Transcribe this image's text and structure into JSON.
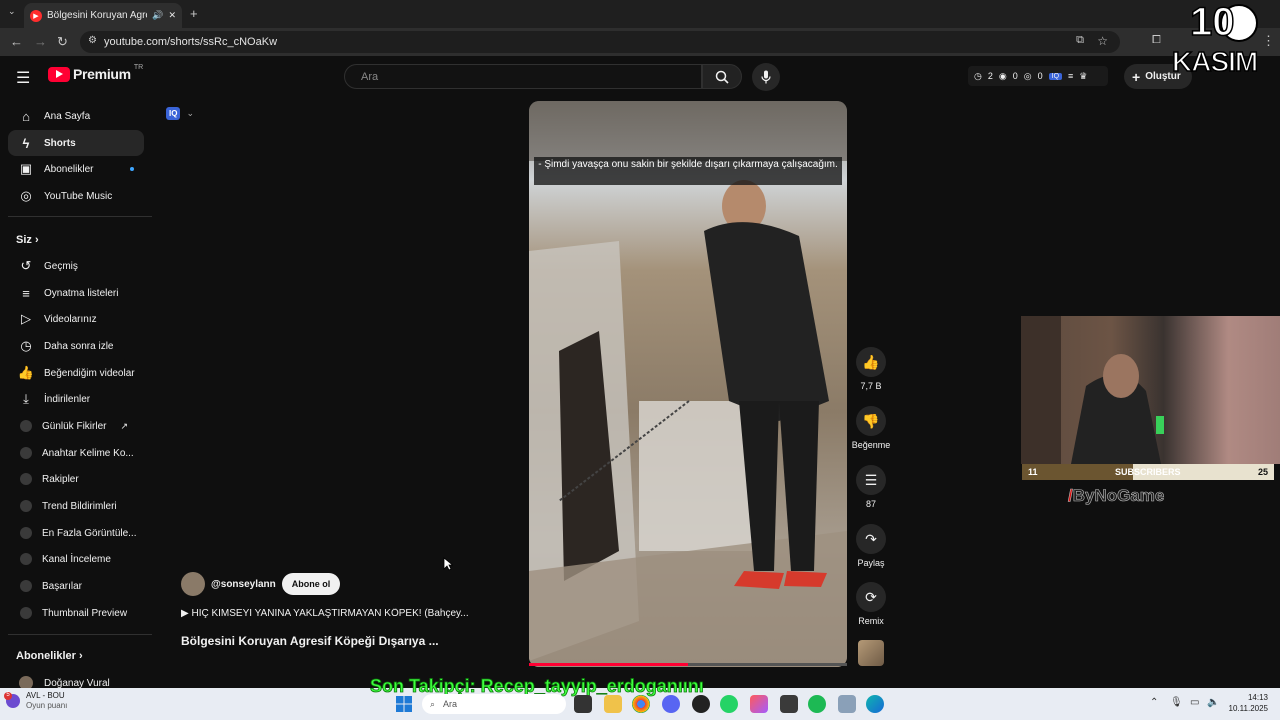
{
  "browser": {
    "tab_title": "Bölgesini Koruyan Agresif K",
    "tab_close": "✕",
    "new_tab": "+",
    "url": "youtube.com/shorts/ssRc_cNOaKw"
  },
  "youtube": {
    "logo_text": "Premium",
    "logo_region": "TR",
    "search_placeholder": "Ara",
    "stats": {
      "a": "2",
      "b": "0",
      "c": "0"
    },
    "create_label": "Oluştur"
  },
  "sidebar": {
    "main": [
      {
        "label": "Ana Sayfa",
        "icon": "home-icon"
      },
      {
        "label": "Shorts",
        "icon": "shorts-icon"
      },
      {
        "label": "Abonelikler",
        "icon": "subscriptions-icon"
      },
      {
        "label": "YouTube Music",
        "icon": "music-icon"
      }
    ],
    "you_header": "Siz",
    "you": [
      {
        "label": "Geçmiş"
      },
      {
        "label": "Oynatma listeleri"
      },
      {
        "label": "Videolarınız"
      },
      {
        "label": "Daha sonra izle"
      },
      {
        "label": "Beğendiğim videolar"
      },
      {
        "label": "İndirilenler"
      }
    ],
    "ext": [
      {
        "label": "Günlük Fikirler"
      },
      {
        "label": "Anahtar Kelime Ko..."
      },
      {
        "label": "Rakipler"
      },
      {
        "label": "Trend Bildirimleri"
      },
      {
        "label": "En Fazla Görüntüle..."
      },
      {
        "label": "Kanal İnceleme"
      },
      {
        "label": "Başarılar"
      },
      {
        "label": "Thumbnail Preview"
      }
    ],
    "subs_header": "Abonelikler",
    "subs": [
      {
        "label": "Doğanay Vural"
      }
    ]
  },
  "short": {
    "caption": "- Şimdi yavaşça onu sakin bir şekilde dışarı çıkarmaya çalışacağım.",
    "progress": 0.5,
    "likes": "7,7 B",
    "dislike_label": "Beğenme",
    "comments": "87",
    "share_label": "Paylaş",
    "remix_label": "Remix",
    "channel": "@sonseylann",
    "subscribe_label": "Abone ol",
    "description": "▶ HİÇ KİMSEYİ YANINA YAKLAŞTIRMAYAN KÖPEK! (Bahçey...",
    "title": "Bölgesini Koruyan Agresif Köpeği Dışarıya ..."
  },
  "overlay": {
    "sub_left": "11",
    "sub_mid": "SUBSCRIBERS",
    "sub_right": "25",
    "sub_progress": 0.44,
    "brand": "ByNoGame",
    "date_num": "10",
    "date_month": "KASIM",
    "ticker": "Son Takipçi: Recep_tayyip_erdoganıını"
  },
  "taskbar": {
    "weather_badge": "5",
    "weather_line1": "AVL - BOU",
    "weather_line2": "Oyun puanı",
    "search": "Ara",
    "time": "14:13",
    "date": "10.11.2025"
  }
}
